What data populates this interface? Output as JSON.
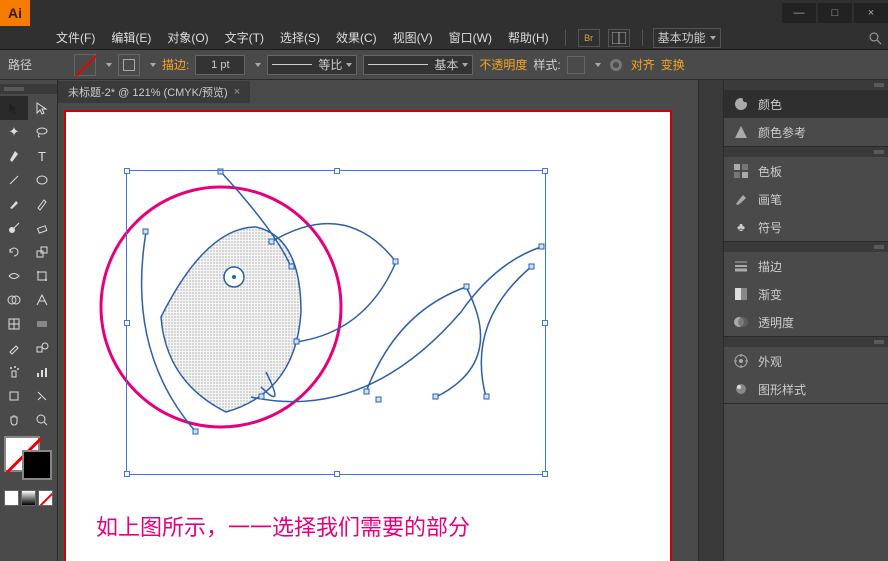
{
  "app": {
    "logo": "Ai"
  },
  "window": {
    "min": "—",
    "max": "□",
    "close": "×"
  },
  "menu": {
    "items": [
      "文件(F)",
      "编辑(E)",
      "对象(O)",
      "文字(T)",
      "选择(S)",
      "效果(C)",
      "视图(V)",
      "窗口(W)",
      "帮助(H)"
    ],
    "workspace": "基本功能"
  },
  "controlbar": {
    "pathLabel": "路径",
    "strokeLabel": "描边:",
    "strokeWeight": "1 pt",
    "profileLabel": "等比",
    "brushLabel": "基本",
    "opacityLabel": "不透明度",
    "styleLabel": "样式:",
    "alignLabel": "对齐",
    "transformLabel": "变换"
  },
  "document": {
    "tabTitle": "未标题-2* @ 121% (CMYK/预览)",
    "caption": "如上图所示，一一选择我们需要的部分"
  },
  "panels": {
    "color": "颜色",
    "colorGuide": "颜色参考",
    "swatches": "色板",
    "brushes": "画笔",
    "symbols": "符号",
    "stroke": "描边",
    "gradient": "渐变",
    "transparency": "透明度",
    "appearance": "外观",
    "graphicStyles": "图形样式"
  }
}
